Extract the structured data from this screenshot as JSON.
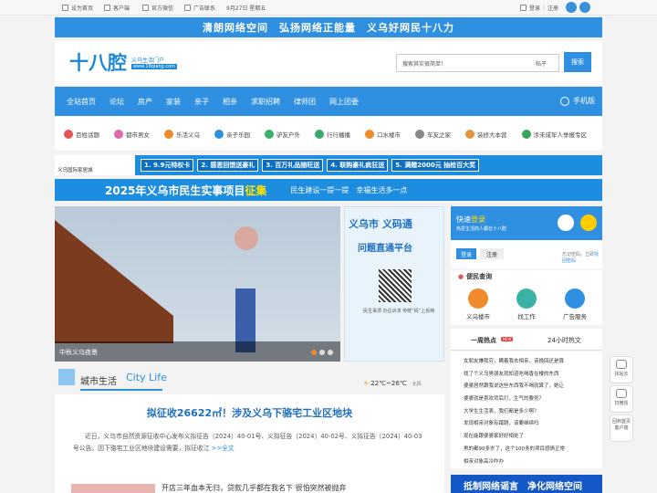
{
  "topbar": {
    "items": [
      "设为首页",
      "客户端",
      "官方微信",
      "广告联系"
    ],
    "date": "9月27日 星期五",
    "login": "登录",
    "register": "注册"
  },
  "banner_top": {
    "text": "清朗网络空间　弘扬网络正能量　义乌好网民十八力"
  },
  "header": {
    "logo": "十八腔",
    "logo_sub": "义乌生活门户",
    "logo_url": "www.18qiang.com",
    "search_placeholder": "搜索其实很简单！",
    "search_type": "帖子",
    "search_button": "搜索"
  },
  "nav": {
    "items": [
      "全站首页",
      "论坛",
      "房产",
      "家装",
      "亲子",
      "相亲",
      "求职招聘",
      "律师团",
      "网上团委"
    ],
    "mobile": "手机版"
  },
  "subnav": {
    "items": [
      "百姓话题",
      "都市男女",
      "乐活义乌",
      "亲子乐园",
      "驴友户外",
      "行行播播",
      "口水楼市",
      "车友之家",
      "装修大本营",
      "涉未成年人举报专区"
    ],
    "colors": [
      "#e25555",
      "#e06aa8",
      "#f08a2b",
      "#2f8fe0",
      "#3bb26b",
      "#39a86b",
      "#f08a2b",
      "#888888",
      "#e2973a",
      "#3aa55a"
    ]
  },
  "ad_strip": {
    "brand": "义乌国际家居城",
    "cells": [
      "1. 9.9元特权卡",
      "2. 感恩回馈送豪礼",
      "3. 百万礼品随旺送",
      "4. 联购豪礼疯狂送",
      "5. 满赠2000元 抽检百大奖"
    ]
  },
  "ad_banner": {
    "title_a": "2025年义乌市民生实事项目",
    "title_b": "征集",
    "slogan": "民生建设一提一提　幸福生活多一点"
  },
  "slideshow": {
    "caption": "中秋义乌夜景"
  },
  "qr_panel": {
    "title1": "义乌市 义码通",
    "title2": "问题直通平台",
    "note": "民生事项 办企诉求 传统“码”上反映"
  },
  "login_box": {
    "title_a": "快速",
    "title_b": "登录",
    "subtitle": "热爱生活的人都在十八腔",
    "login_btn": "登录",
    "register_btn": "注册",
    "forgot": "忘记密码，立即",
    "forgot_link": "找回密码"
  },
  "services": {
    "title": "便民查询",
    "items": [
      "义乌楼市",
      "找工作",
      "广告服务"
    ],
    "colors": [
      "#f08a2b",
      "#3bb2a6",
      "#2f8fe0"
    ]
  },
  "hot_tabs": {
    "week": "一周热点",
    "new_badge": "NEW",
    "day": "24小时热文"
  },
  "hot_list": [
    "女朋友嫌我穷，瞒着我去相亲，该挽回还是算",
    "找了个义乌男朋友就知道吃喝香在楼的东西",
    "婆婆居然跟我说这些东西我不喝就算了，她让",
    "婆婆就是喜欢背后打，生气的要死？",
    "大学生生活表，我们都是多少啊？",
    "发现相亲对象有蹊跷，该要继续吗",
    "现在能跟婆婆家好好相处了",
    "男的都90多岁了，这个100多的项目感情正常",
    "相亲对象高冷咋办"
  ],
  "bottom_ad": {
    "text": "抵制网络谣言　净化网络空间"
  },
  "city": {
    "cn": "城市生活",
    "en": "City Life"
  },
  "weather": {
    "temp": "22℃~26℃",
    "place": "北风"
  },
  "news": {
    "title": "拟征收26622㎡！涉及义乌下骆宅工业区地块",
    "desc": "近日，义乌市自然资源征收中心发布义拟征告〔2024〕40-01号、义拟征告〔2024〕40-02号、义拟征告〔2024〕40-03号公告。因下骆宅工业区地块建设需要，拟征收江",
    "more": ">>全文",
    "headline2": "开店三年血本无归，贷款几乎都在我名下 很怕突然被抛弃"
  },
  "side_tools": [
    "找站长",
    "扫微信",
    "回到首页客户端"
  ]
}
